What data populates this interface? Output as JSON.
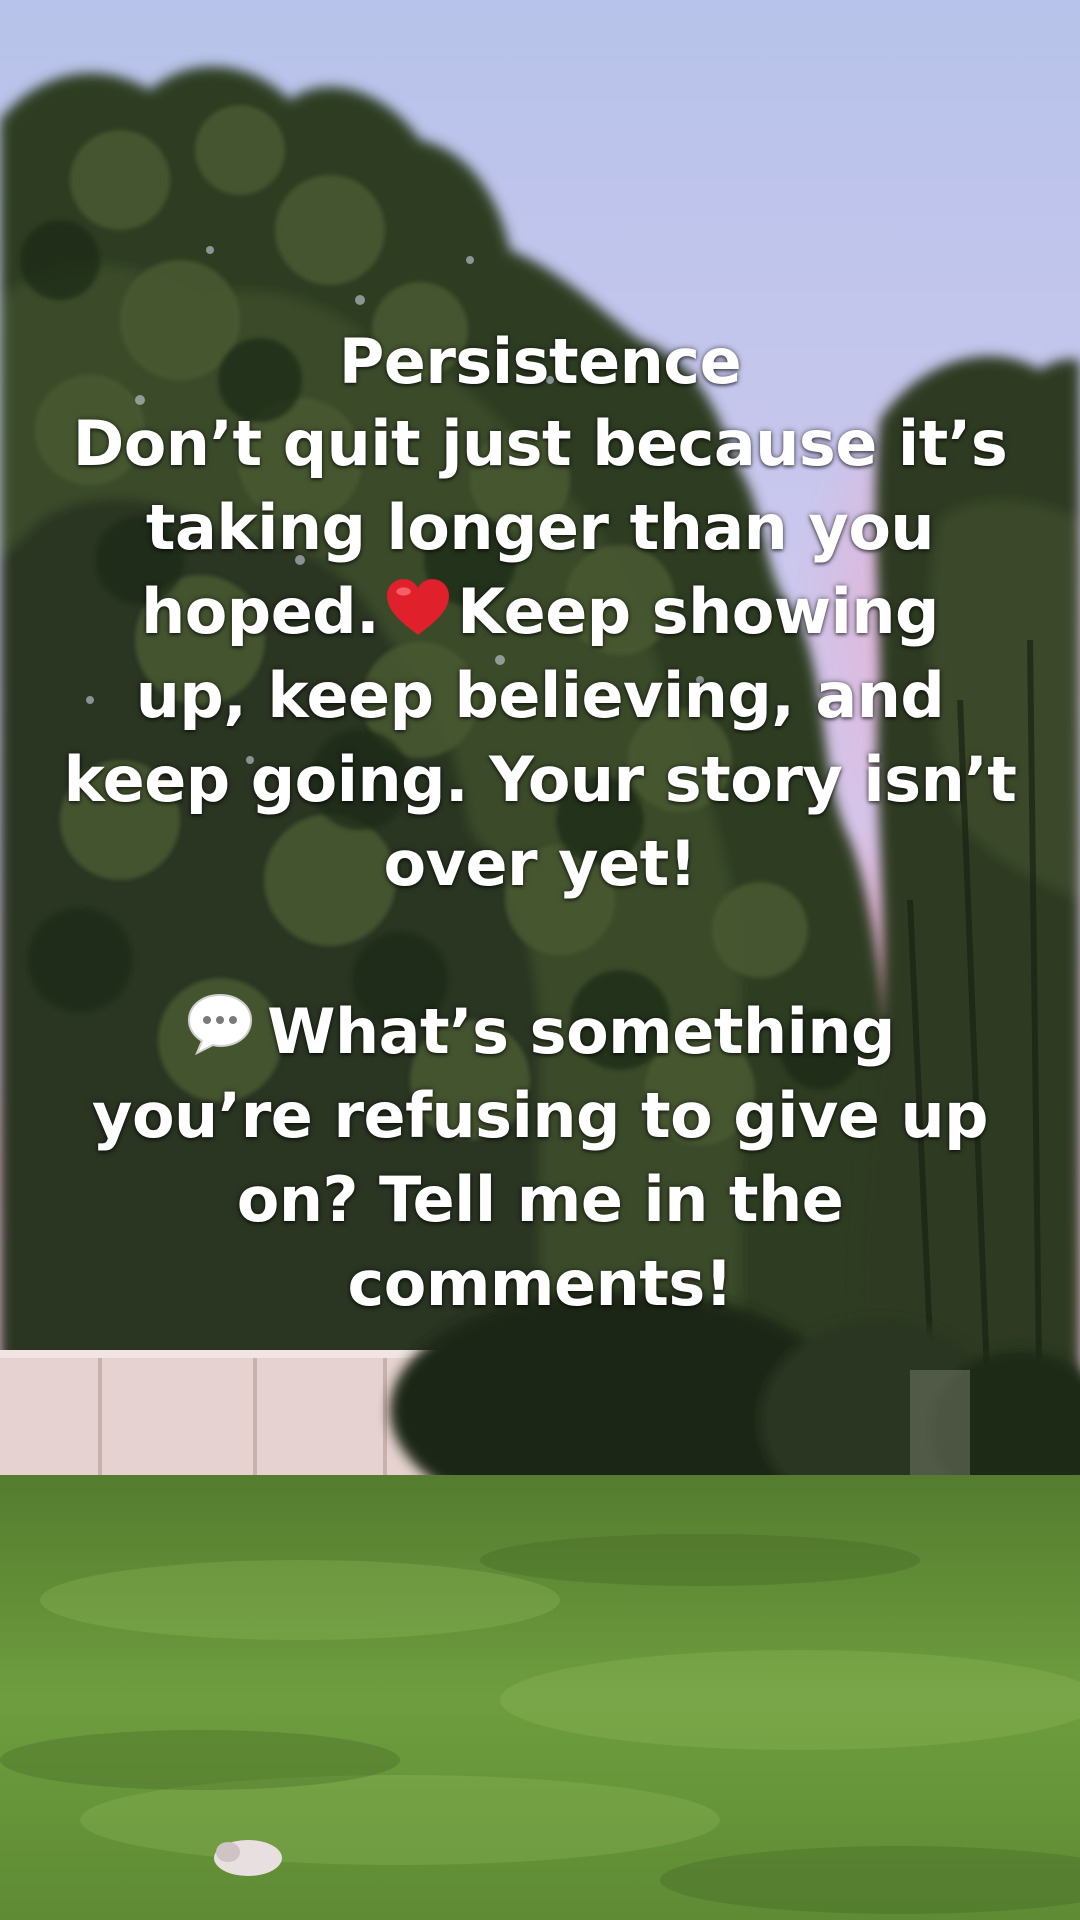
{
  "overlay": {
    "title": "Persistence",
    "para1": {
      "line1": "Don’t quit just because it’s",
      "line2": "taking longer than you",
      "line3_before": "hoped.",
      "line3_after": "Keep showing",
      "line4": "up, keep believing, and",
      "line5": "keep going. Your story isn’t",
      "line6": "over yet!"
    },
    "para2": {
      "line1_after": "What’s something",
      "line2": "you’re refusing to give up",
      "line3": "on? Tell me in the",
      "line4": "comments!"
    },
    "icons": {
      "heart": "red-heart-emoji",
      "bubble": "speech-bubble-emoji"
    }
  },
  "scene": {
    "description_colors": {
      "sky_top": "#b9c6ea",
      "sky_pink": "#e8b7cf",
      "foliage_dark": "#263220",
      "foliage_mid": "#3e4e2c",
      "fence": "#e3cfcc",
      "grass": "#6c9a3c",
      "text": "#ffffff",
      "heart": "#e0202a"
    }
  }
}
